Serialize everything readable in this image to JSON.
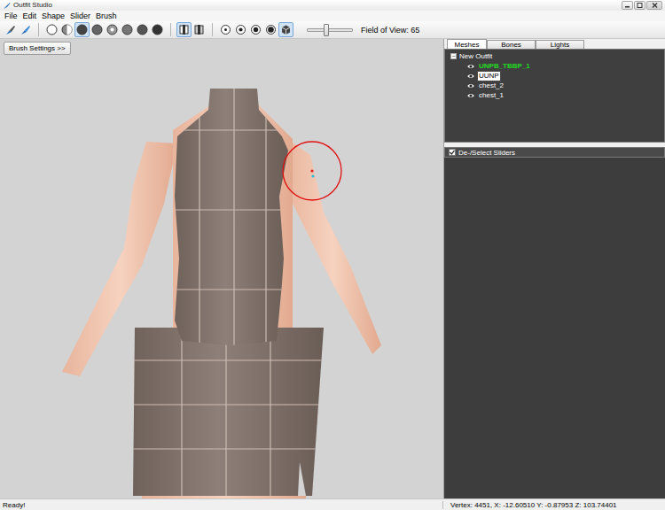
{
  "window": {
    "title": "Outfit Studio"
  },
  "menu": [
    "File",
    "Edit",
    "Shape",
    "Slider",
    "Brush"
  ],
  "toolbar": {
    "groups": [
      [
        {
          "selected": false
        },
        {
          "selected": false
        }
      ],
      [
        {
          "selected": false
        },
        {
          "selected": false
        },
        {
          "selected": true
        },
        {
          "selected": false
        },
        {
          "selected": false
        },
        {
          "selected": false
        },
        {
          "selected": false
        },
        {
          "selected": false
        }
      ],
      [
        {
          "selected": true
        },
        {
          "selected": false
        }
      ],
      [
        {
          "selected": false
        },
        {
          "selected": false
        },
        {
          "selected": false
        },
        {
          "selected": false
        },
        {
          "selected": true
        }
      ]
    ],
    "fov": {
      "label": "Field of View: 65",
      "level": 0.42
    }
  },
  "brush_settings": "Brush Settings >>",
  "tabs": [
    {
      "label": "Meshes",
      "selected": true
    },
    {
      "label": "Bones",
      "selected": false
    },
    {
      "label": "Lights",
      "selected": false
    }
  ],
  "tree": {
    "root": "New Outfit",
    "expanded": true,
    "collapse_glyph": "−",
    "items": [
      {
        "label": "UNPB_TBBP_1",
        "visible": true,
        "selected": false,
        "color": "#22dd22"
      },
      {
        "label": "UUNP",
        "visible": true,
        "selected": true,
        "color": "#000000"
      },
      {
        "label": "chest_2",
        "visible": true,
        "selected": false,
        "color": "#ffffff"
      },
      {
        "label": "chest_1",
        "visible": true,
        "selected": false,
        "color": "#ffffff"
      }
    ]
  },
  "sliders_panel": {
    "label": "De-/Select Sliders",
    "checked": true
  },
  "status_bar": {
    "message": "Ready!",
    "vertex": "Vertex: 4451, X: -12.60510 Y: -0.87953 Z: 103.74401"
  }
}
